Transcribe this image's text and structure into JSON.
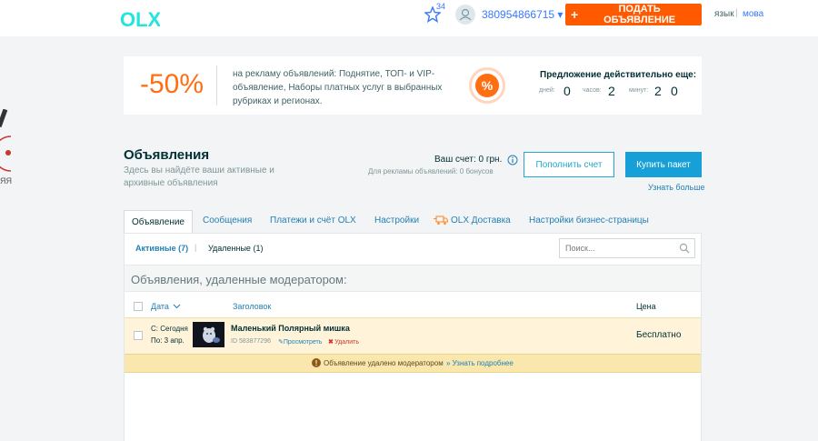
{
  "header": {
    "logo_text": "OLX",
    "favorites_count": "34",
    "phone": "380954866715 ▾",
    "post_button": "ПОДАТЬ ОБЪЯВЛЕНИЕ",
    "lang_ru": "язык",
    "lang_ua": "мова"
  },
  "promo": {
    "discount": "-50%",
    "text": "на рекламу объявлений: Поднятие, ТОП- и VIP-объявление, Наборы платных услуг в выбранных рубриках и регионах.",
    "badge": "%",
    "offer_title": "Предложение действительно еще:",
    "days_label": "дней:",
    "days": "0",
    "hours_label": "часов:",
    "hours": "2",
    "minutes_label": "минут:",
    "min_tens": "2",
    "min_ones": "0"
  },
  "ads": {
    "title": "Объявления",
    "subtitle": "Здесь вы найдёте ваши активные и архивные объявления",
    "account": "Ваш счет: 0 грн.",
    "bonus": "Для рекламы объявлений: 0 бонусов",
    "topup_button": "Пополнить счет",
    "buy_button": "Купить пакет",
    "learn_more": "Узнать больше"
  },
  "tabs": [
    {
      "label": "Объявление"
    },
    {
      "label": "Сообщения"
    },
    {
      "label": "Платежи и счёт OLX"
    },
    {
      "label": "Настройки"
    },
    {
      "label": "OLX Доставка"
    },
    {
      "label": "Настройки бизнес-страницы"
    }
  ],
  "subtabs": {
    "active": "Активные (7)",
    "separator": "|",
    "deleted": "Удаленные (1)"
  },
  "search": {
    "placeholder": "Поиск..."
  },
  "removed_title": "Объявления, удаленные модератором:",
  "columns": {
    "date": "Дата",
    "title": "Заголовок",
    "price": "Цена"
  },
  "row": {
    "from": "С: Сегодня",
    "to": "По: 3 апр.",
    "title": "Маленький Полярный мишка",
    "id": "ID 583877296",
    "view": "Просмотреть",
    "delete": "Удалить",
    "price": "Бесплатно"
  },
  "notice": {
    "text": "Объявление удалено модератором",
    "link": "Узнать подробнее"
  },
  "edge_text": "ЯЯ",
  "colors": {
    "accent": "#ff5a00",
    "link": "#2280b5",
    "notice_bg": "#f9e7ae",
    "row_bg": "#fff4d9"
  }
}
